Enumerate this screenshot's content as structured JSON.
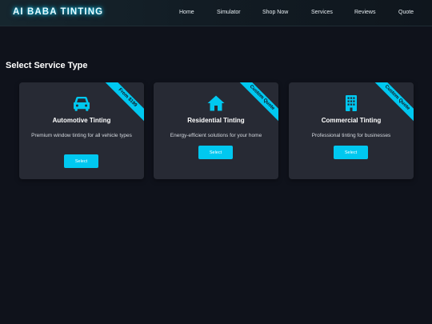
{
  "header": {
    "logo": "AI BABA TINTING",
    "nav": [
      "Home",
      "Simulator",
      "Shop Now",
      "Services",
      "Reviews",
      "Quote"
    ]
  },
  "main": {
    "section_title": "Select Service Type",
    "cards": [
      {
        "icon": "car-icon",
        "badge": "From $199",
        "title": "Automotive Tinting",
        "description": "Premium window tinting for all vehicle types",
        "button_label": "Select"
      },
      {
        "icon": "home-icon",
        "badge": "Custom Quote",
        "title": "Residential Tinting",
        "description": "Energy-efficient solutions for your home",
        "button_label": "Select"
      },
      {
        "icon": "building-icon",
        "badge": "Custom Quote",
        "title": "Commercial Tinting",
        "description": "Professional tinting for businesses",
        "button_label": "Select"
      }
    ]
  },
  "colors": {
    "accent": "#00c8f0",
    "background": "#0f121b",
    "card": "#272a34"
  }
}
